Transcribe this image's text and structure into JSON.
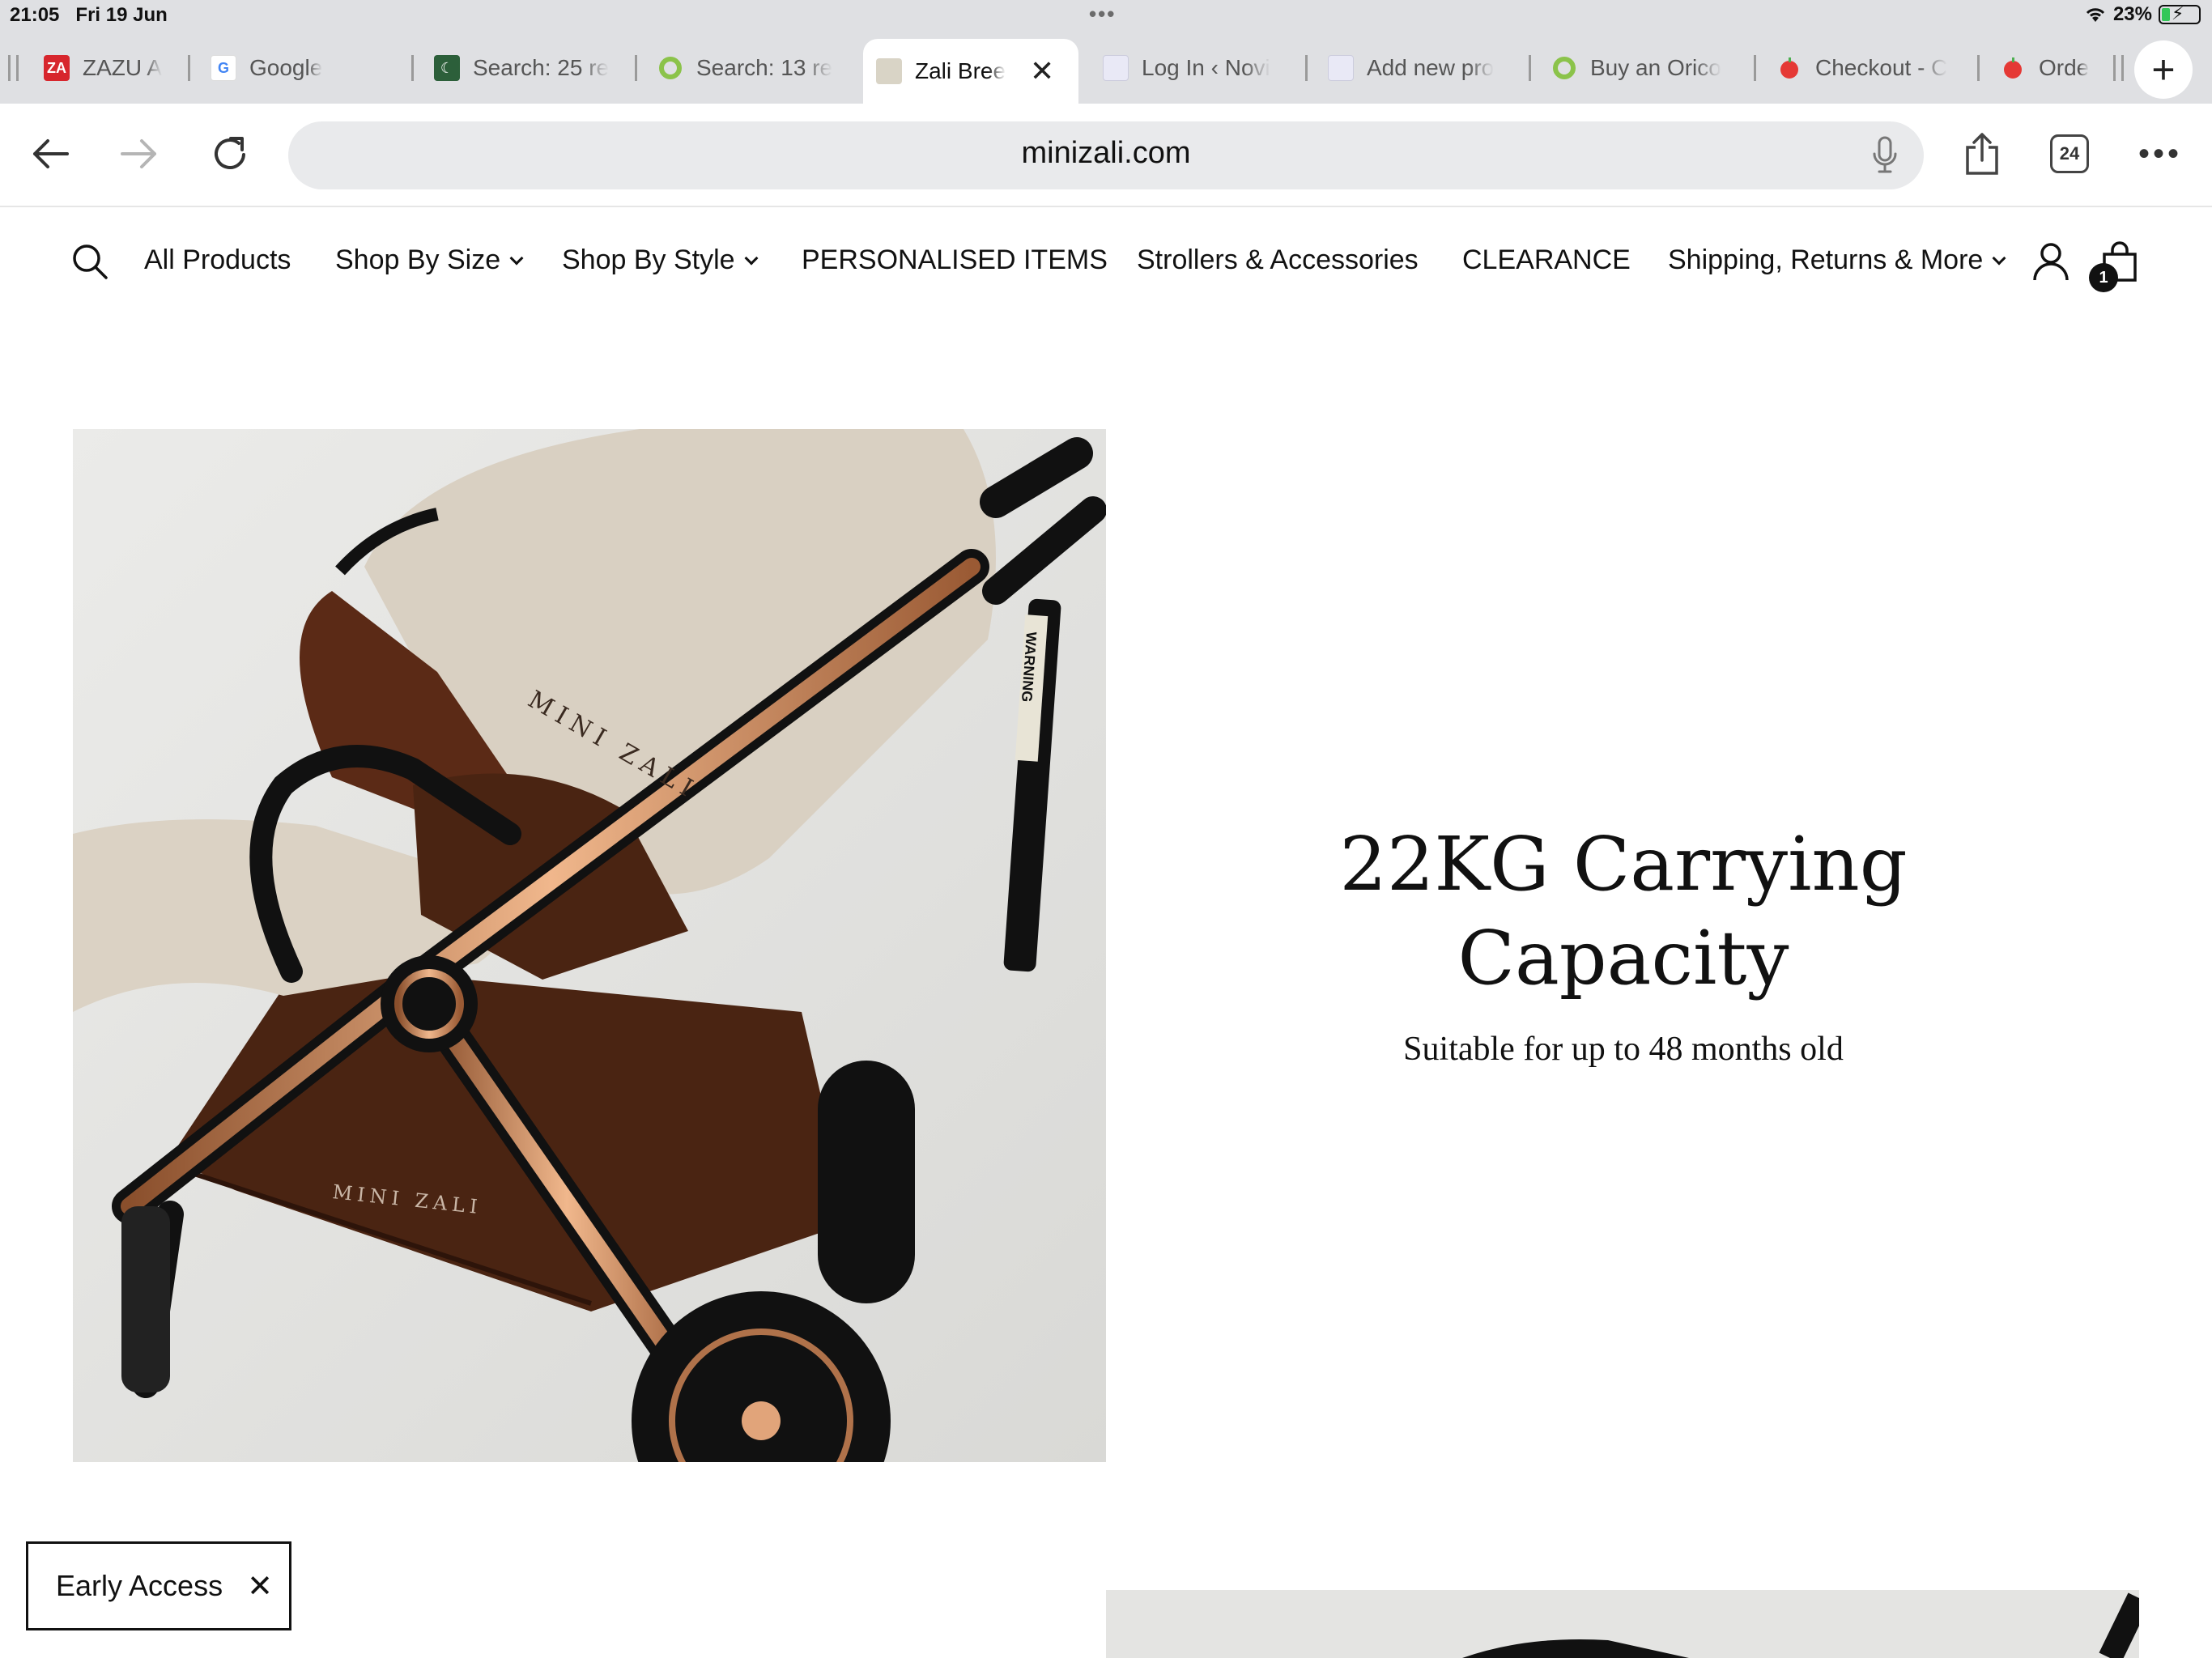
{
  "status_bar": {
    "time": "21:05",
    "date": "Fri 19 Jun",
    "battery_percent": "23%",
    "battery_level": 0.23,
    "battery_color": "#34c759",
    "icons": [
      "wifi-icon",
      "battery-charging-icon"
    ]
  },
  "tabs": [
    {
      "label": "ZAZU A",
      "favicon": "ZA",
      "favicon_color": "#d7262d",
      "active": false
    },
    {
      "label": "Google",
      "favicon": "G",
      "favicon_color": "#ffffff",
      "active": false
    },
    {
      "label": "Search: 25 re",
      "favicon": "",
      "favicon_color": "#2c5f3a",
      "active": false
    },
    {
      "label": "Search: 13 re",
      "favicon": "",
      "favicon_color": "#8bc34a",
      "active": false
    },
    {
      "label": "Zali Bree",
      "favicon": "",
      "favicon_color": "#d9d4c6",
      "active": true
    },
    {
      "label": "Log In ‹ Novi",
      "favicon": "",
      "favicon_color": "#e9e9f6",
      "active": false
    },
    {
      "label": "Add new pro",
      "favicon": "",
      "favicon_color": "#e9e9f6",
      "active": false
    },
    {
      "label": "Buy an Orico",
      "favicon": "",
      "favicon_color": "#8bc34a",
      "active": false
    },
    {
      "label": "Checkout - C",
      "favicon": "",
      "favicon_color": "#e53935",
      "active": false
    },
    {
      "label": "Orde",
      "favicon": "",
      "favicon_color": "#e53935",
      "active": false
    }
  ],
  "toolbar": {
    "url": "minizali.com",
    "tab_count": "24",
    "icons": [
      "back-arrow-icon",
      "forward-arrow-icon",
      "reload-icon",
      "microphone-icon",
      "share-icon",
      "tabs-icon",
      "more-icon",
      "new-tab-icon"
    ]
  },
  "site_nav": {
    "items": [
      {
        "label": "All Products",
        "has_dropdown": false
      },
      {
        "label": "Shop By Size",
        "has_dropdown": true
      },
      {
        "label": "Shop By Style",
        "has_dropdown": true
      },
      {
        "label": "PERSONALISED ITEMS",
        "has_dropdown": false
      },
      {
        "label": "Strollers & Accessories",
        "has_dropdown": false
      },
      {
        "label": "CLEARANCE",
        "has_dropdown": false
      },
      {
        "label": "Shipping, Returns & More",
        "has_dropdown": true
      }
    ],
    "cart_count": "1"
  },
  "hero": {
    "title_line1": "22KG Carrying",
    "title_line2": "Capacity",
    "subtitle": "Suitable for up to 48 months old",
    "brand_print_1": "MINI ZALI",
    "brand_print_2": "MINI ZALI",
    "tag_text": "WARNING"
  },
  "early_access": {
    "label": "Early Access"
  }
}
